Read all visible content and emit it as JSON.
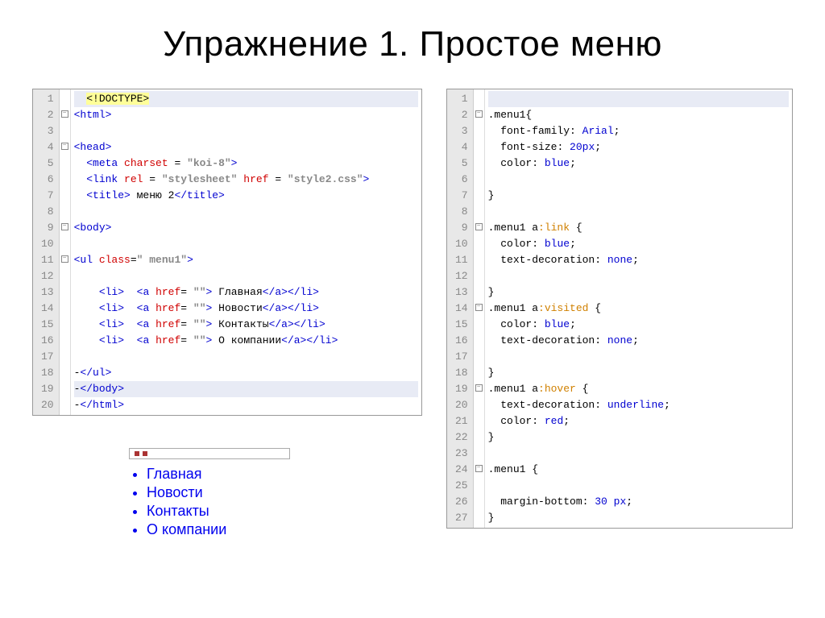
{
  "title": "Упражнение 1. Простое меню",
  "leftEditor": {
    "lineCount": 20,
    "lines": [
      {
        "type": "doctype",
        "raw": "<!DOCTYPE>"
      },
      {
        "type": "tag-open",
        "name": "html"
      },
      {
        "type": "blank"
      },
      {
        "type": "tag-open",
        "name": "head"
      },
      {
        "type": "meta",
        "attr": "charset",
        "val": "koi-8"
      },
      {
        "type": "link",
        "attrs": [
          [
            "rel",
            "stylesheet"
          ],
          [
            "href",
            "style2.css"
          ]
        ]
      },
      {
        "type": "titled",
        "open": "title",
        "text": " меню 2",
        "close": "title"
      },
      {
        "type": "blank"
      },
      {
        "type": "tag-open",
        "name": "body"
      },
      {
        "type": "blank"
      },
      {
        "type": "ul-open",
        "attr": "class",
        "val": " menu1"
      },
      {
        "type": "blank"
      },
      {
        "type": "li",
        "text": "Главная"
      },
      {
        "type": "li",
        "text": "Новости"
      },
      {
        "type": "li",
        "text": "Контакты"
      },
      {
        "type": "li",
        "text": "О компании"
      },
      {
        "type": "blank"
      },
      {
        "type": "tag-close",
        "name": "ul"
      },
      {
        "type": "tag-close",
        "name": "body"
      },
      {
        "type": "tag-close",
        "name": "html"
      }
    ]
  },
  "rightEditor": {
    "lineCount": 27,
    "lines": [
      {
        "t": "blank-hl"
      },
      {
        "t": "sel",
        "s": ".menu1{"
      },
      {
        "t": "prop",
        "k": "font-family",
        "v": "Arial;"
      },
      {
        "t": "prop",
        "k": "font-size",
        "v": "20px;"
      },
      {
        "t": "prop",
        "k": "color",
        "v": "blue;"
      },
      {
        "t": "blank"
      },
      {
        "t": "close"
      },
      {
        "t": "blank"
      },
      {
        "t": "sel",
        "s": ".menu1 a:link {"
      },
      {
        "t": "prop",
        "k": "color",
        "v": "blue;"
      },
      {
        "t": "prop",
        "k": "text-decoration",
        "v": "none;"
      },
      {
        "t": "blank"
      },
      {
        "t": "close"
      },
      {
        "t": "sel",
        "s": ".menu1 a:visited {"
      },
      {
        "t": "prop",
        "k": "color",
        "v": "blue;"
      },
      {
        "t": "prop",
        "k": "text-decoration",
        "v": "none;"
      },
      {
        "t": "blank"
      },
      {
        "t": "close"
      },
      {
        "t": "sel",
        "s": ".menu1 a:hover {"
      },
      {
        "t": "prop",
        "k": "text-decoration",
        "v": "underline;"
      },
      {
        "t": "prop",
        "k": "color",
        "v": "red;"
      },
      {
        "t": "close"
      },
      {
        "t": "blank"
      },
      {
        "t": "sel",
        "s": ".menu1 {"
      },
      {
        "t": "blank"
      },
      {
        "t": "prop",
        "k": "margin-bottom",
        "v": "30 px;"
      },
      {
        "t": "close"
      }
    ]
  },
  "preview": {
    "items": [
      "Главная",
      "Новости",
      "Контакты",
      "О компании"
    ]
  }
}
